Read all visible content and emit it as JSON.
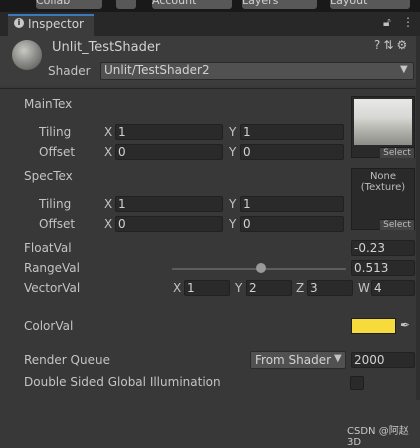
{
  "toolbar": {
    "collab_label": "Collab",
    "account_label": "Account",
    "layers_label": "Layers",
    "layout_label": "Layout"
  },
  "tab": {
    "title": "Inspector",
    "lock_icon": "lock-icon",
    "menu_icon": "kebab-icon"
  },
  "header": {
    "material_name": "Unlit_TestShader",
    "shader_label": "Shader",
    "shader_value": "Unlit/TestShader2",
    "icons": [
      "help-icon",
      "presets-icon",
      "settings-icon"
    ]
  },
  "properties": {
    "maintex": {
      "label": "MainTex",
      "tiling_label": "Tiling",
      "offset_label": "Offset",
      "x_label": "X",
      "y_label": "Y",
      "tiling_x": "1",
      "tiling_y": "1",
      "offset_x": "0",
      "offset_y": "0",
      "select_label": "Select"
    },
    "spectex": {
      "label": "SpecTex",
      "tiling_label": "Tiling",
      "offset_label": "Offset",
      "x_label": "X",
      "y_label": "Y",
      "tiling_x": "1",
      "tiling_y": "1",
      "offset_x": "0",
      "offset_y": "0",
      "slot_text": "None\n(Texture)",
      "select_label": "Select"
    },
    "floatval": {
      "label": "FloatVal",
      "value": "-0.23"
    },
    "rangeval": {
      "label": "RangeVal",
      "value": "0.513",
      "slider_fraction": 0.513
    },
    "vectorval": {
      "label": "VectorVal",
      "x_label": "X",
      "y_label": "Y",
      "z_label": "Z",
      "w_label": "W",
      "x": "1",
      "y": "2",
      "z": "3",
      "w": "4"
    },
    "colorval": {
      "label": "ColorVal",
      "color": "#f7da3b"
    },
    "render_queue": {
      "label": "Render Queue",
      "mode": "From Shader",
      "value": "2000"
    },
    "double_sided_gi": {
      "label": "Double Sided Global Illumination",
      "checked": false
    }
  },
  "watermark": "CSDN @阿赵3D",
  "colors": {
    "accent": "#3a79bb",
    "background": "#383838"
  }
}
